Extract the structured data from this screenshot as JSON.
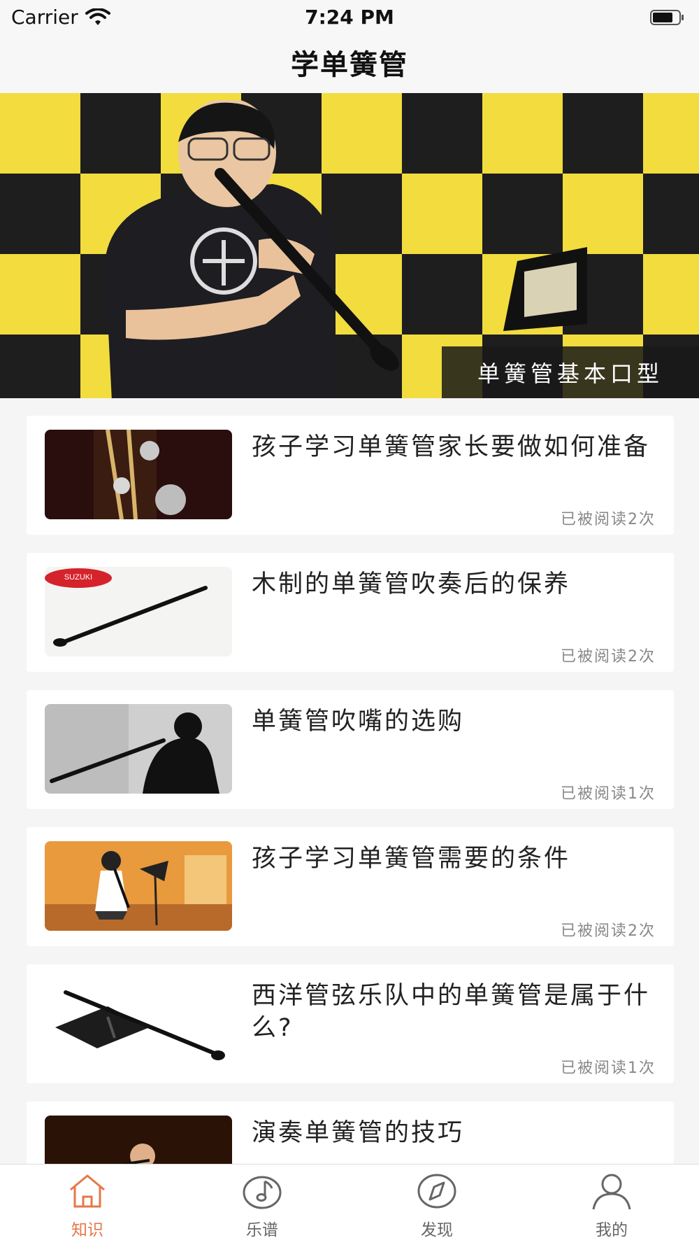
{
  "status_bar": {
    "carrier": "Carrier",
    "time": "7:24 PM"
  },
  "nav": {
    "title": "学单簧管"
  },
  "banner": {
    "caption": "单簧管基本口型"
  },
  "articles": [
    {
      "title": "孩子学习单簧管家长要做如何准备",
      "reads": "已被阅读2次"
    },
    {
      "title": "木制的单簧管吹奏后的保养",
      "reads": "已被阅读2次"
    },
    {
      "title": "单簧管吹嘴的选购",
      "reads": "已被阅读1次"
    },
    {
      "title": "孩子学习单簧管需要的条件",
      "reads": "已被阅读2次"
    },
    {
      "title": "西洋管弦乐队中的单簧管是属于什么?",
      "reads": "已被阅读1次"
    },
    {
      "title": "演奏单簧管的技巧",
      "reads": ""
    }
  ],
  "tabs": [
    {
      "label": "知识",
      "icon": "home-icon"
    },
    {
      "label": "乐谱",
      "icon": "music-note-icon"
    },
    {
      "label": "发现",
      "icon": "compass-icon"
    },
    {
      "label": "我的",
      "icon": "person-icon"
    }
  ],
  "colors": {
    "accent": "#e5784a",
    "inactive": "#666666"
  }
}
